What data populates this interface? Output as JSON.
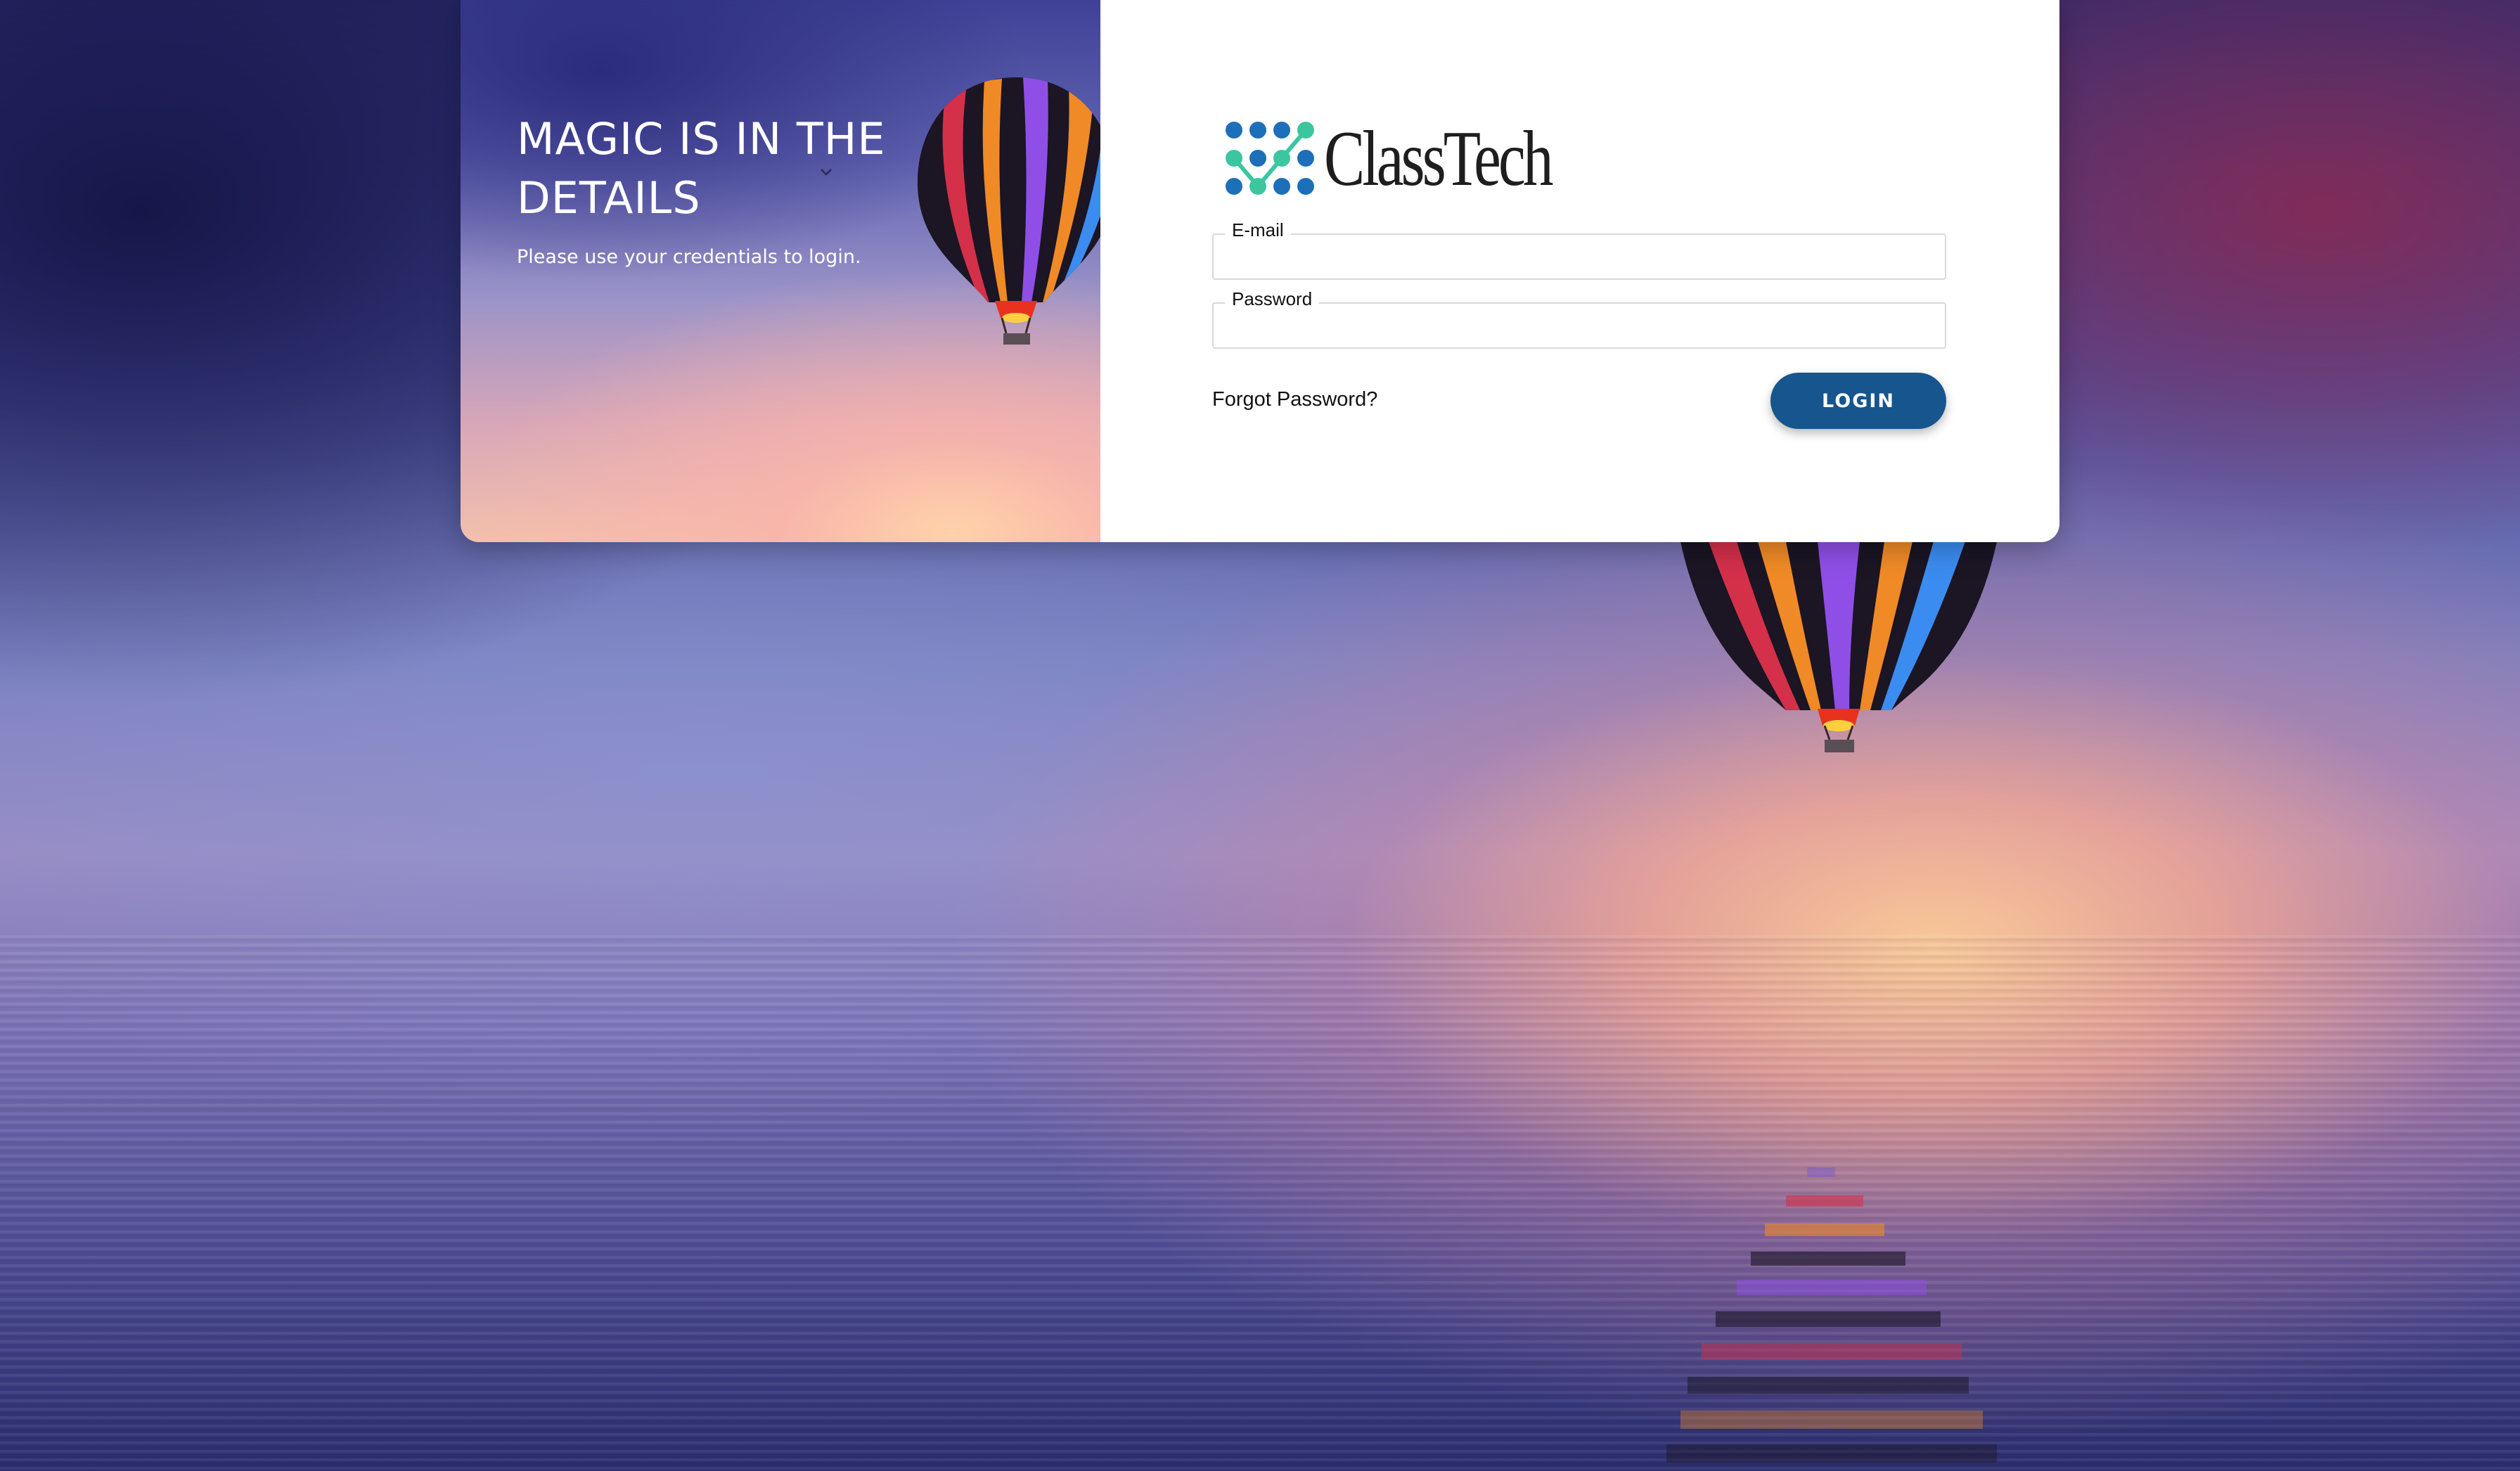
{
  "hero": {
    "title": "MAGIC IS IN THE DETAILS",
    "subtitle": "Please use your credentials to login."
  },
  "brand": {
    "name": "ClassTech",
    "logo_icon": "classtech-dot-grid-logo",
    "colors": {
      "dots_blue": "#1c6fb8",
      "dots_green": "#3cc6a0"
    }
  },
  "form": {
    "email_label": "E-mail",
    "email_value": "",
    "password_label": "Password",
    "password_value": "",
    "forgot_link": "Forgot Password?",
    "login_button": "LOGIN"
  },
  "theme": {
    "button_color": "#16558e",
    "field_border": "#d7d9dd"
  }
}
